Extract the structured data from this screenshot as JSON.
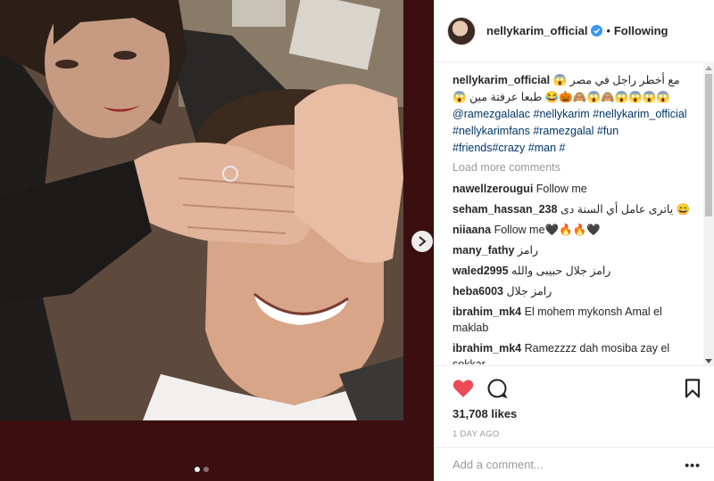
{
  "post": {
    "author": "nellykarim_official",
    "follow_status": "Following",
    "separator": "•",
    "caption_user": "nellykarim_official",
    "caption_text": "مع أخطر راجل في مصر 😱😱😱😱😱🙈😱🙈🎃😂 طبعا عرفتة مين 😱",
    "caption_tags": "@ramezgalalac #nellykarim #nellykarim_official #nellykarimfans #ramezgalal #fun #friends#crazy #man #",
    "load_more": "Load more comments",
    "comments": [
      {
        "user": "nawellzerougui",
        "text": "Follow me"
      },
      {
        "user": "seham_hassan_238",
        "text": "ياترى عامل أي السنة دى 😄"
      },
      {
        "user": "niiaana",
        "text": "Follow me🖤🔥🔥🖤"
      },
      {
        "user": "many_fathy",
        "text": "رامز"
      },
      {
        "user": "waled2995",
        "text": "رامز جلال حبيبى والله"
      },
      {
        "user": "heba6003",
        "text": "رامز جلال"
      },
      {
        "user": "ibrahim_mk4",
        "text": "El mohem mykonsh Amal el maklab"
      },
      {
        "user": "ibrahim_mk4",
        "text": "Ramezzzz dah mosiba zay el sokkar"
      }
    ],
    "likes": "31,708 likes",
    "time": "1 DAY AGO",
    "add_comment_placeholder": "Add a comment...",
    "more_options": "•••"
  },
  "colors": {
    "like_red": "#ed4956",
    "verified_blue": "#3897f0",
    "hashtag": "#003569",
    "muted": "#999999",
    "photo_bg": "#3b0f0f"
  },
  "media": {
    "carousel_count": 2,
    "carousel_active": 1
  }
}
